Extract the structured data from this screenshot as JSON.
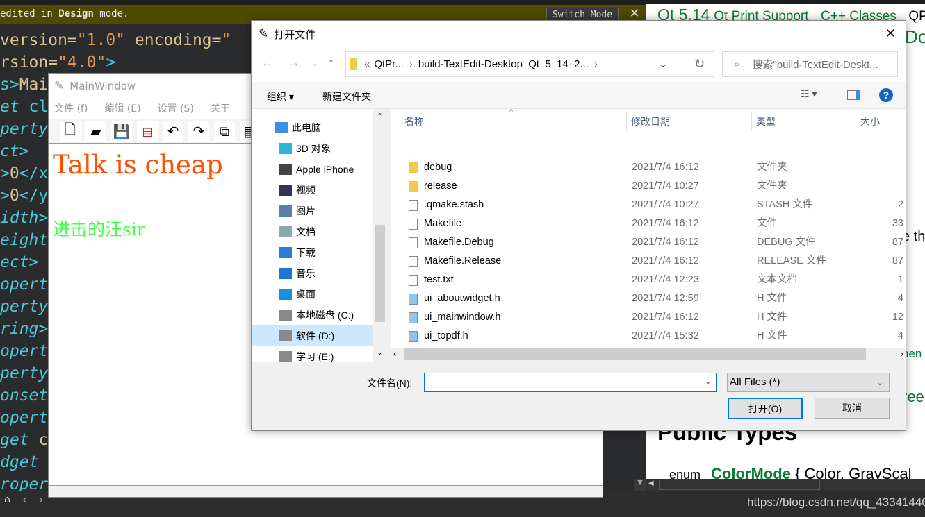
{
  "banner": {
    "pre": "edited in ",
    "bold": "Design",
    "post": " mode.",
    "switch_label": "Switch Mode",
    "close": "✕"
  },
  "code_lines": [
    [
      [
        "a",
        "version="
      ],
      [
        "s",
        "\"1.0\""
      ],
      [
        "a",
        " encoding="
      ],
      [
        "s",
        "\""
      ]
    ],
    [
      [
        "a",
        "rsion="
      ],
      [
        "s",
        "\"4.0\""
      ],
      [
        "p",
        ">"
      ]
    ],
    [
      [
        "p",
        "s>"
      ],
      [
        "a",
        "Mai"
      ]
    ],
    [
      [
        "",
        "et "
      ],
      [
        "p",
        "cl"
      ]
    ],
    [
      [
        "",
        "perty"
      ]
    ],
    [
      [
        "",
        "ct>"
      ]
    ],
    [
      [
        "p",
        ">"
      ],
      [
        "a",
        "0"
      ],
      [
        "p",
        "</x"
      ]
    ],
    [
      [
        "p",
        ">"
      ],
      [
        "a",
        "0"
      ],
      [
        "p",
        "</y"
      ]
    ],
    [
      [
        "",
        "idth>"
      ]
    ],
    [
      [
        "",
        "eight"
      ]
    ],
    [
      [
        "",
        "ect>"
      ]
    ],
    [
      [
        "",
        "opert"
      ]
    ],
    [
      [
        "",
        "perty"
      ]
    ],
    [
      [
        "",
        "ring>"
      ]
    ],
    [
      [
        "",
        "opert"
      ]
    ],
    [
      [
        "",
        "perty"
      ]
    ],
    [
      [
        "",
        "onset"
      ]
    ],
    [
      [
        "",
        "opert"
      ]
    ],
    [
      [
        "",
        "get "
      ],
      [
        "a",
        "c"
      ]
    ],
    [
      [
        "",
        "dget "
      ]
    ],
    [
      [
        "",
        "roper"
      ]
    ]
  ],
  "docs": {
    "breadcrumb_version": "Qt 5.14",
    "breadcrumb_module": "Qt Print Support",
    "breadcrumb_classes": "C++ Classes",
    "breadcrumb_class": "QP",
    "doc_frag": "Do",
    "frag_the": "e th",
    "frag_men": "nen",
    "frag_ree": "ree",
    "public_types": "Public Types",
    "enum_kw": "enum",
    "enum_name": "ColorMode",
    "enum_rest": " { Color, GrayScal"
  },
  "watermark": "https://blog.csdn.net/qq_43341440",
  "mainwindow": {
    "title": "MainWindow",
    "menus": [
      "文件 (f)",
      "编辑 (E)",
      "设置 (S)",
      "关于"
    ],
    "text1": "Talk is cheap",
    "text2": "进击的汪sir"
  },
  "dialog": {
    "title": "打开文件",
    "close": "✕",
    "address": {
      "overflow": "«",
      "crumb1": "QtPr...",
      "crumb2": "build-TextEdit-Desktop_Qt_5_14_2..."
    },
    "search_placeholder": "搜索\"build-TextEdit-Deskt...",
    "organize": "组织 ▾",
    "new_folder": "新建文件夹",
    "help": "?",
    "nav": [
      {
        "label": "此电脑",
        "icon": "computer-icon",
        "color": "#3a8ee6"
      },
      {
        "label": "3D 对象",
        "icon": "3d-objects-icon",
        "color": "#2bb5d6"
      },
      {
        "label": "Apple iPhone",
        "icon": "phone-icon",
        "color": "#444"
      },
      {
        "label": "视频",
        "icon": "video-icon",
        "color": "#335"
      },
      {
        "label": "图片",
        "icon": "pictures-icon",
        "color": "#5a7fa8"
      },
      {
        "label": "文档",
        "icon": "documents-icon",
        "color": "#8aa"
      },
      {
        "label": "下载",
        "icon": "download-icon",
        "color": "#2a7fd4"
      },
      {
        "label": "音乐",
        "icon": "music-icon",
        "color": "#1a78d0"
      },
      {
        "label": "桌面",
        "icon": "desktop-icon",
        "color": "#1a8ee0"
      },
      {
        "label": "本地磁盘 (C:)",
        "icon": "drive-icon",
        "color": "#888"
      },
      {
        "label": "软件 (D:)",
        "icon": "drive-icon",
        "color": "#888"
      },
      {
        "label": "学习 (E:)",
        "icon": "drive-icon",
        "color": "#888"
      }
    ],
    "columns": [
      "名称",
      "修改日期",
      "类型",
      "大小"
    ],
    "files": [
      {
        "name": "debug",
        "date": "2021/7/4 16:12",
        "type": "文件夹",
        "size": "",
        "icon": "folder"
      },
      {
        "name": "release",
        "date": "2021/7/4 10:27",
        "type": "文件夹",
        "size": "",
        "icon": "folder"
      },
      {
        "name": ".qmake.stash",
        "date": "2021/7/4 10:27",
        "type": "STASH 文件",
        "size": "2",
        "icon": "file"
      },
      {
        "name": "Makefile",
        "date": "2021/7/4 16:12",
        "type": "文件",
        "size": "33",
        "icon": "file"
      },
      {
        "name": "Makefile.Debug",
        "date": "2021/7/4 16:12",
        "type": "DEBUG 文件",
        "size": "87",
        "icon": "file"
      },
      {
        "name": "Makefile.Release",
        "date": "2021/7/4 16:12",
        "type": "RELEASE 文件",
        "size": "87",
        "icon": "file"
      },
      {
        "name": "test.txt",
        "date": "2021/7/4 12:23",
        "type": "文本文档",
        "size": "1",
        "icon": "text"
      },
      {
        "name": "ui_aboutwidget.h",
        "date": "2021/7/4 12:59",
        "type": "H 文件",
        "size": "4",
        "icon": "header"
      },
      {
        "name": "ui_mainwindow.h",
        "date": "2021/7/4 16:12",
        "type": "H 文件",
        "size": "12",
        "icon": "header"
      },
      {
        "name": "ui_topdf.h",
        "date": "2021/7/4 15:32",
        "type": "H 文件",
        "size": "4",
        "icon": "header"
      }
    ],
    "filename_label": "文件名(N):",
    "filename_value": "",
    "filter": "All Files  (*)",
    "open": "打开(O)",
    "cancel": "取消"
  },
  "colors": {
    "accent": "#0078d7",
    "docs_green": "#0d7a35"
  }
}
